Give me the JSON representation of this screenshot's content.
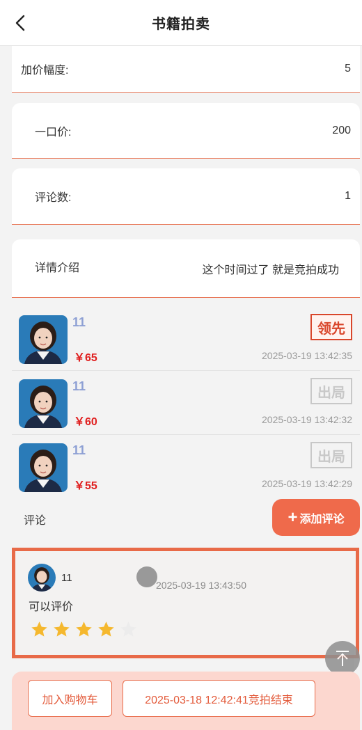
{
  "header": {
    "title": "书籍拍卖",
    "back_icon": "chevron-left-icon"
  },
  "info": {
    "increment": {
      "label": "加价幅度:",
      "value": "5"
    },
    "buy_now": {
      "label": "一口价:",
      "value": "200"
    },
    "comment_count": {
      "label": "评论数:",
      "value": "1"
    },
    "details": {
      "label": "详情介绍",
      "value": "这个时间过了 就是竞拍成功"
    }
  },
  "bids": [
    {
      "name": "11",
      "price": "￥65",
      "status": "领先",
      "time": "2025-03-19 13:42:35"
    },
    {
      "name": "11",
      "price": "￥60",
      "status": "出局",
      "time": "2025-03-19 13:42:32"
    },
    {
      "name": "11",
      "price": "￥55",
      "status": "出局",
      "time": "2025-03-19 13:42:29"
    }
  ],
  "comments": {
    "label": "评论",
    "add_button": "添加评论",
    "items": [
      {
        "name": "11",
        "time": "2025-03-19 13:43:50",
        "text": "可以评价",
        "rating": 4,
        "max_rating": 5
      }
    ]
  },
  "footer": {
    "add_to_cart": "加入购物车",
    "end_notice": "2025-03-18 12:42:41竞拍结束"
  },
  "colors": {
    "accent": "#ef6a4b",
    "lead": "#d9462b",
    "price": "#e02020",
    "star": "#f5b82e"
  }
}
